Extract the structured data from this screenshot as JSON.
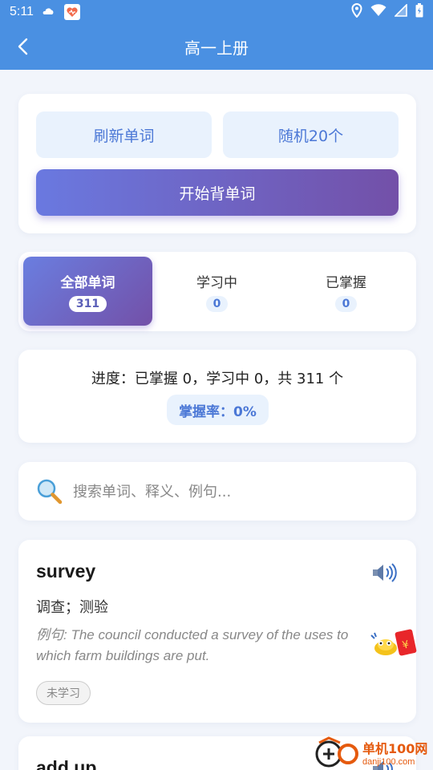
{
  "status_bar": {
    "time": "5:11"
  },
  "header": {
    "title": "高一上册"
  },
  "actions": {
    "refresh_label": "刷新单词",
    "random_label": "随机20个",
    "start_label": "开始背单词"
  },
  "tabs": [
    {
      "label": "全部单词",
      "count": "311"
    },
    {
      "label": "学习中",
      "count": "0"
    },
    {
      "label": "已掌握",
      "count": "0"
    }
  ],
  "progress": {
    "text": "进度：已掌握 0，学习中 0，共 311 个",
    "rate": "掌握率：0%"
  },
  "search": {
    "placeholder": "搜索单词、释义、例句..."
  },
  "words": [
    {
      "word": "survey",
      "meaning": "调查；测验",
      "example_prefix": "例句:",
      "example": "The council conducted a survey of the uses to which farm buildings are put.",
      "status": "未学习"
    },
    {
      "word": "add up"
    }
  ],
  "watermark": {
    "name": "单机100网",
    "url": "danji100.com"
  },
  "colors": {
    "primary": "#4a90e2",
    "accent_start": "#6a79e0",
    "accent_end": "#7350a8",
    "soft_bg": "#e9f2fd",
    "soft_text": "#4c78d6"
  }
}
